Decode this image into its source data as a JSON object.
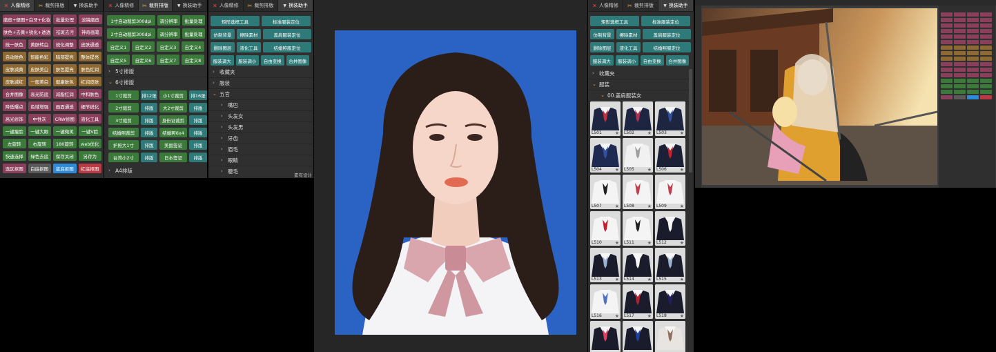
{
  "panel1": {
    "tabs": [
      {
        "label": "人像精修",
        "icon": "x-icon"
      },
      {
        "label": "裁剪排版",
        "icon": "crop-icon"
      },
      {
        "label": "换装助手",
        "icon": "shirt-icon"
      }
    ],
    "active_tab": 0,
    "buttons": [
      [
        "磨皮+便图+白牙+化妆",
        "批量处理",
        "滤镜磨皮"
      ],
      [
        "肤色+去黄+锐化+透透",
        "祛斑去污",
        "神奇画笔"
      ],
      [
        "统一肤色",
        "黄肤转白",
        "锐化调整",
        "皮肤通透"
      ],
      [
        "自动肤色",
        "智能色彩",
        "暗部提亮",
        "整体提亮"
      ],
      [
        "皮肤减黄",
        "皮肤美白",
        "肤色提亮",
        "肤色红润"
      ],
      [
        "皮肤减红",
        "一般美白",
        "健康肤色",
        "红润皮肤"
      ],
      [
        "合并图像",
        "高光防底",
        "减脂红润",
        "中和肤色"
      ],
      [
        "降低曝点",
        "色域增强",
        "画面通透",
        "细节锐化"
      ],
      [
        "高光修饰",
        "中性灰",
        "CRW修图",
        "液化工具"
      ],
      [
        "一键瘦脸",
        "一键大眼",
        "一键微笑",
        "一键V脸"
      ],
      [
        "左旋转",
        "右旋转",
        "180旋转",
        "web优化"
      ],
      [
        "快速选择",
        "绿色去底",
        "保存关闭",
        "另存为"
      ],
      [
        "选区抠图",
        "白底抠图",
        "蓝底抠图",
        "红底抠图"
      ]
    ]
  },
  "panel2": {
    "tabs": [
      {
        "label": "人像精修",
        "icon": "x-icon"
      },
      {
        "label": "裁剪排版",
        "icon": "crop-icon"
      },
      {
        "label": "换装助手",
        "icon": "shirt-icon"
      }
    ],
    "active_tab": 1,
    "buttons": [
      [
        "1寸自动裁剪300dpi",
        "调分辨率",
        "批量处理"
      ],
      [
        "2寸自动裁剪300dpi",
        "调分辨率",
        "批量处理"
      ],
      [
        "自定义1",
        "自定义2",
        "自定义3",
        "自定义4"
      ],
      [
        "自定义5",
        "自定义6",
        "自定义7",
        "自定义8"
      ]
    ],
    "sections": [
      {
        "label": "5寸排版",
        "open": false
      },
      {
        "label": "6寸排版",
        "open": true
      }
    ],
    "six_inch_rows": [
      [
        "1寸裁剪",
        "排12张",
        "小1寸裁剪",
        "排16张"
      ],
      [
        "2寸裁剪",
        "排版",
        "大2寸裁剪",
        "排版"
      ],
      [
        "3寸裁剪",
        "排版",
        "身份证裁剪",
        "排版"
      ],
      [
        "结婚照裁剪",
        "排版",
        "结婚照6x4",
        "排版"
      ],
      [
        "护照大1寸",
        "排版",
        "美国签证",
        "排版"
      ],
      [
        "台湾小2寸",
        "排版",
        "日本签证",
        "排版"
      ]
    ],
    "a4_label": "A4排版"
  },
  "panel3": {
    "tabs": [
      {
        "label": "人像精修",
        "icon": "x-icon"
      },
      {
        "label": "裁剪排版",
        "icon": "crop-icon"
      },
      {
        "label": "换装助手",
        "icon": "shirt-icon"
      }
    ],
    "active_tab": 2,
    "buttons": [
      [
        "矩形选框工具",
        "标准服装定位"
      ],
      [
        "仿制背景",
        "擦除素材",
        "盖肩服装定位"
      ],
      [
        "删除图层",
        "液化工具",
        "结婚照服定位"
      ],
      [
        "服装调大",
        "服装调小",
        "自由变换",
        "合并图像"
      ]
    ],
    "tree": [
      {
        "label": "收藏夹",
        "level": 0,
        "open": false
      },
      {
        "label": "服装",
        "level": 0,
        "open": false
      },
      {
        "label": "五官",
        "level": 0,
        "open": true
      },
      {
        "label": "嘴巴",
        "level": 1,
        "open": false
      },
      {
        "label": "头发女",
        "level": 1,
        "open": false
      },
      {
        "label": "头发男",
        "level": 1,
        "open": false
      },
      {
        "label": "牙齿",
        "level": 1,
        "open": false
      },
      {
        "label": "眉毛",
        "level": 1,
        "open": false
      },
      {
        "label": "眼睛",
        "level": 1,
        "open": false
      },
      {
        "label": "睫毛",
        "level": 1,
        "open": false
      }
    ],
    "footer": "素有设计"
  },
  "panel4": {
    "tabs": [
      {
        "label": "人像精修",
        "icon": "x-icon"
      },
      {
        "label": "裁剪排版",
        "icon": "crop-icon"
      },
      {
        "label": "换装助手",
        "icon": "shirt-icon"
      }
    ],
    "active_tab": 2,
    "buttons": [
      [
        "矩形选框工具",
        "标准服装定位"
      ],
      [
        "仿制背景",
        "擦除素材",
        "盖肩服装定位"
      ],
      [
        "删除图层",
        "液化工具",
        "结婚照服定位"
      ],
      [
        "服装调大",
        "服装调小",
        "自由变换",
        "合并图像"
      ]
    ],
    "tree": [
      {
        "label": "收藏夹",
        "level": 0,
        "open": false
      },
      {
        "label": "服装",
        "level": 0,
        "open": true
      },
      {
        "label": "00.盖肩服装女",
        "level": 1,
        "open": true
      }
    ],
    "thumbs": [
      "L501",
      "L502",
      "L503",
      "L504",
      "L505",
      "L506",
      "L507",
      "L508",
      "L509",
      "L510",
      "L511",
      "L512",
      "L513",
      "L514",
      "L515",
      "L516",
      "L517",
      "L518",
      "",
      "",
      ""
    ]
  },
  "colors": {
    "pink": "#8a3f5c",
    "gold": "#8e6a32",
    "green": "#3c7a3c",
    "teal": "#2e7a78",
    "blue": "#2d8ad8",
    "red": "#b83a45",
    "photo_bg": "#2a63c4"
  }
}
